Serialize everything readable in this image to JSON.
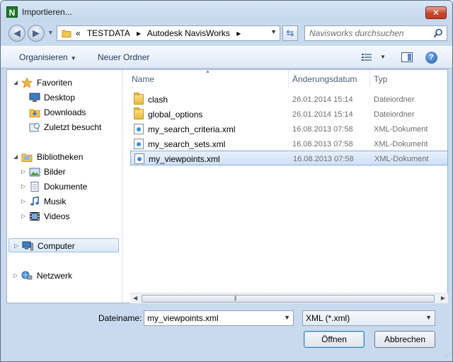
{
  "window": {
    "title": "Importieren...",
    "app_icon_letter": "N",
    "close_glyph": "✕"
  },
  "navigation": {
    "back_glyph": "◀",
    "forward_glyph": "▶",
    "address_prefix": "«",
    "breadcrumbs": [
      "TESTDATA",
      "Autodesk NavisWorks"
    ],
    "separator": "▸",
    "search_placeholder": "Navisworks durchsuchen"
  },
  "toolbar": {
    "organize_label": "Organisieren",
    "new_folder_label": "Neuer Ordner"
  },
  "sidebar": {
    "favorites": {
      "label": "Favoriten",
      "items": [
        "Desktop",
        "Downloads",
        "Zuletzt besucht"
      ]
    },
    "libraries": {
      "label": "Bibliotheken",
      "items": [
        "Bilder",
        "Dokumente",
        "Musik",
        "Videos"
      ]
    },
    "computer_label": "Computer",
    "network_label": "Netzwerk"
  },
  "file_list": {
    "columns": {
      "name": "Name",
      "date": "Änderungsdatum",
      "type": "Typ"
    },
    "rows": [
      {
        "name": "clash",
        "date": "26.01.2014 15:14",
        "type": "Dateiordner",
        "icon": "folder-icon"
      },
      {
        "name": "global_options",
        "date": "26.01.2014 15:14",
        "type": "Dateiordner",
        "icon": "folder-icon"
      },
      {
        "name": "my_search_criteria.xml",
        "date": "16.08.2013 07:58",
        "type": "XML-Dokument",
        "icon": "xml-file-icon"
      },
      {
        "name": "my_search_sets.xml",
        "date": "16.08.2013 07:58",
        "type": "XML-Dokument",
        "icon": "xml-file-icon"
      },
      {
        "name": "my_viewpoints.xml",
        "date": "16.08.2013 07:58",
        "type": "XML-Dokument",
        "icon": "xml-file-icon",
        "selected": true
      }
    ]
  },
  "footer": {
    "filename_label": "Dateiname:",
    "filename_value": "my_viewpoints.xml",
    "filetype_value": "XML (*.xml)",
    "open_label": "Öffnen",
    "cancel_label": "Abbrechen"
  },
  "colors": {
    "accent": "#2c6fb8",
    "selection": "#cfe1f7",
    "chrome": "#c9daee"
  }
}
